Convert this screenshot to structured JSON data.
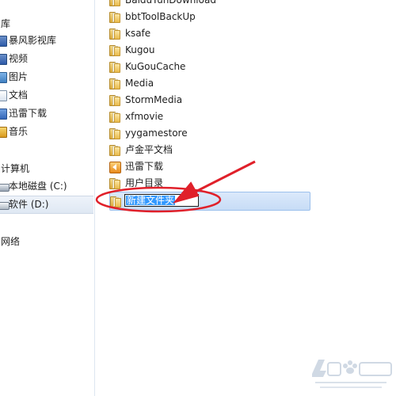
{
  "navigation": {
    "library_header": "库",
    "library_items": [
      {
        "label": "暴风影视库",
        "icon": "video-library-icon"
      },
      {
        "label": "视频",
        "icon": "video-icon"
      },
      {
        "label": "图片",
        "icon": "picture-icon"
      },
      {
        "label": "文档",
        "icon": "document-icon"
      },
      {
        "label": "迅雷下载",
        "icon": "thunder-download-icon"
      },
      {
        "label": "音乐",
        "icon": "music-icon"
      }
    ],
    "computer_header": "计算机",
    "drives": [
      {
        "label": "本地磁盘 (C:)",
        "icon": "drive-icon"
      },
      {
        "label": "软件 (D:)",
        "icon": "drive-icon",
        "selected": true
      }
    ],
    "network_header": "网络"
  },
  "files": [
    {
      "name": "BaiduYunDownload",
      "icon": "folder-icon"
    },
    {
      "name": "bbtToolBackUp",
      "icon": "folder-icon"
    },
    {
      "name": "ksafe",
      "icon": "folder-icon"
    },
    {
      "name": "Kugou",
      "icon": "folder-icon"
    },
    {
      "name": "KuGouCache",
      "icon": "folder-icon"
    },
    {
      "name": "Media",
      "icon": "folder-icon"
    },
    {
      "name": "StormMedia",
      "icon": "folder-icon"
    },
    {
      "name": "xfmovie",
      "icon": "folder-icon"
    },
    {
      "name": "yygamestore",
      "icon": "folder-icon"
    },
    {
      "name": "卢金平文档",
      "icon": "folder-icon"
    },
    {
      "name": "迅雷下载",
      "icon": "thunder-folder-icon"
    },
    {
      "name": "用户目录",
      "icon": "folder-icon"
    }
  ],
  "rename": {
    "value": "新建文件夹"
  },
  "colors": {
    "selection": "#3399ff",
    "annotation": "#e0202a"
  }
}
